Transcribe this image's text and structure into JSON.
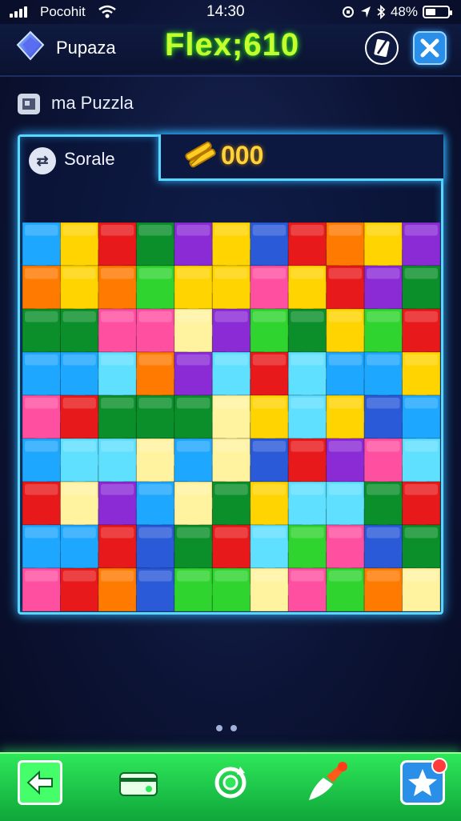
{
  "status_bar": {
    "carrier": "Pocohit",
    "time": "14:30",
    "battery": "48%",
    "battery_level": 0.48
  },
  "header": {
    "app_name": "Pupaza",
    "score_label": "Flex;610"
  },
  "subtitle": "ma Puzzla",
  "board": {
    "sort_label": "Sorale",
    "coins": "000",
    "columns": 11,
    "rows": 9
  },
  "page_dots": 2,
  "icons": {
    "logo": "blue-diamond-icon",
    "edit": "pencil-icon",
    "close": "close-icon",
    "subtitle": "puzzle-box-icon",
    "sort": "sort-icon",
    "coins": "coin-stack-icon",
    "back": "arrow-left-icon",
    "card": "card-icon",
    "swap": "refresh-icon",
    "paint": "brush-icon",
    "favorite": "star-icon"
  },
  "colors": {
    "score": "#c6ff2e",
    "panel_border": "#59d7ff",
    "coins": "#ffd23a",
    "bottom_bar": "#2ee85a",
    "piece_palette": [
      "#e8191b",
      "#ff7a00",
      "#ffd400",
      "#2fd42f",
      "#0a8f2a",
      "#1ea7ff",
      "#2a5ad8",
      "#8a2bd6",
      "#ff4fa0",
      "#5fe0ff",
      "#fff3a0"
    ]
  }
}
